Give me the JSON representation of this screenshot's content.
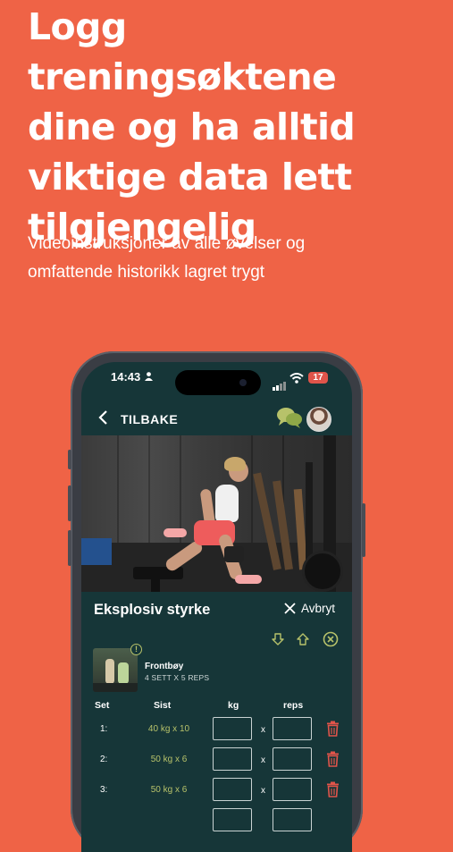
{
  "headline": "Logg treningsøktene\ndine og ha alltid\nviktige data lett\ntilgjengelig",
  "subheadline": "Videoinstruksjoner av alle øvelser og\nomfattende historikk lagret trygt",
  "colors": {
    "background": "#ef6346",
    "app_bg": "#163638",
    "accent_green": "#b7c26a",
    "trash_red": "#e0544a"
  },
  "phone": {
    "status": {
      "time": "14:43",
      "battery": "17"
    },
    "nav": {
      "back_label": "TILBAKE"
    },
    "workout": {
      "title": "Eksplosiv styrke",
      "cancel_label": "Avbryt",
      "exercise": {
        "name": "Frontbøy",
        "meta": "4 SETT X 5 REPS"
      },
      "columns": {
        "set": "Set",
        "last": "Sist",
        "kg": "kg",
        "reps": "reps"
      },
      "rows": [
        {
          "set": "1:",
          "last": "40 kg x 10",
          "x": "x"
        },
        {
          "set": "2:",
          "last": "50 kg x 6",
          "x": "x"
        },
        {
          "set": "3:",
          "last": "50 kg x 6",
          "x": "x"
        }
      ]
    }
  }
}
